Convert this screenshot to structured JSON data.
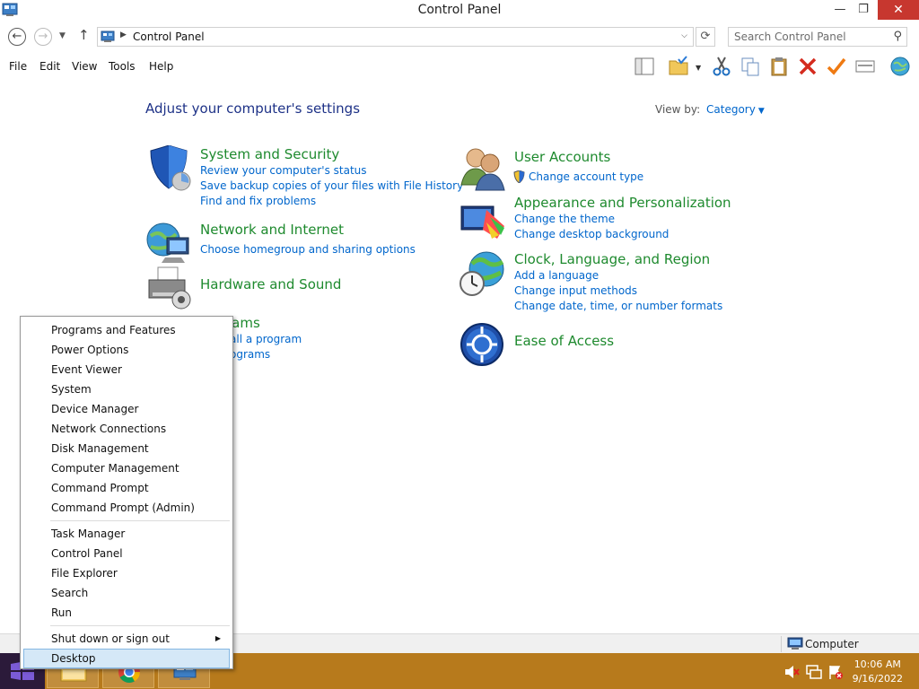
{
  "window": {
    "title": "Control Panel",
    "minimize_label": "—",
    "maximize_label": "❐",
    "close_label": "✕"
  },
  "address_bar": {
    "back_glyph": "←",
    "forward_glyph": "→",
    "recent_glyph": "▼",
    "up_glyph": "↑",
    "separator_glyph": "▶",
    "crumb": "Control Panel",
    "dropdown_glyph": "⌵",
    "refresh_glyph": "⟳",
    "search_placeholder": "Search Control Panel",
    "search_glyph": "⚲"
  },
  "menu": {
    "file": "File",
    "edit": "Edit",
    "view": "View",
    "tools": "Tools",
    "help": "Help"
  },
  "content": {
    "heading": "Adjust your computer's settings",
    "view_by_label": "View by:",
    "view_by_value": "Category",
    "view_by_arrow": "▼",
    "categories": {
      "system": {
        "title": "System and Security",
        "links": [
          "Review your computer's status",
          "Save backup copies of your files with File History",
          "Find and fix problems"
        ]
      },
      "network": {
        "title": "Network and Internet",
        "links": [
          "Choose homegroup and sharing options"
        ]
      },
      "hardware": {
        "title": "Hardware and Sound"
      },
      "programs": {
        "title": "rams",
        "links": [
          "all a program",
          "ograms"
        ]
      },
      "users": {
        "title": "User Accounts",
        "links": [
          "Change account type"
        ]
      },
      "appearance": {
        "title": "Appearance and Personalization",
        "links": [
          "Change the theme",
          "Change desktop background"
        ]
      },
      "clock": {
        "title": "Clock, Language, and Region",
        "links": [
          "Add a language",
          "Change input methods",
          "Change date, time, or number formats"
        ]
      },
      "ease": {
        "title": "Ease of Access"
      }
    }
  },
  "context_menu": {
    "group1": [
      "Programs and Features",
      "Power Options",
      "Event Viewer",
      "System",
      "Device Manager",
      "Network Connections",
      "Disk Management",
      "Computer Management",
      "Command Prompt",
      "Command Prompt (Admin)"
    ],
    "group2": [
      "Task Manager",
      "Control Panel",
      "File Explorer",
      "Search",
      "Run"
    ],
    "shutdown": "Shut down or sign out",
    "submenu_arrow": "▶",
    "desktop": "Desktop"
  },
  "status_bar": {
    "computer_label": "Computer"
  },
  "taskbar": {
    "time": "10:06 AM",
    "date": "9/16/2022"
  },
  "colors": {
    "taskbar": "#b77a1c",
    "link": "#0066cc",
    "category_title": "#1e8a2e",
    "heading": "#1e3287",
    "selection": "#d5e8f7"
  }
}
